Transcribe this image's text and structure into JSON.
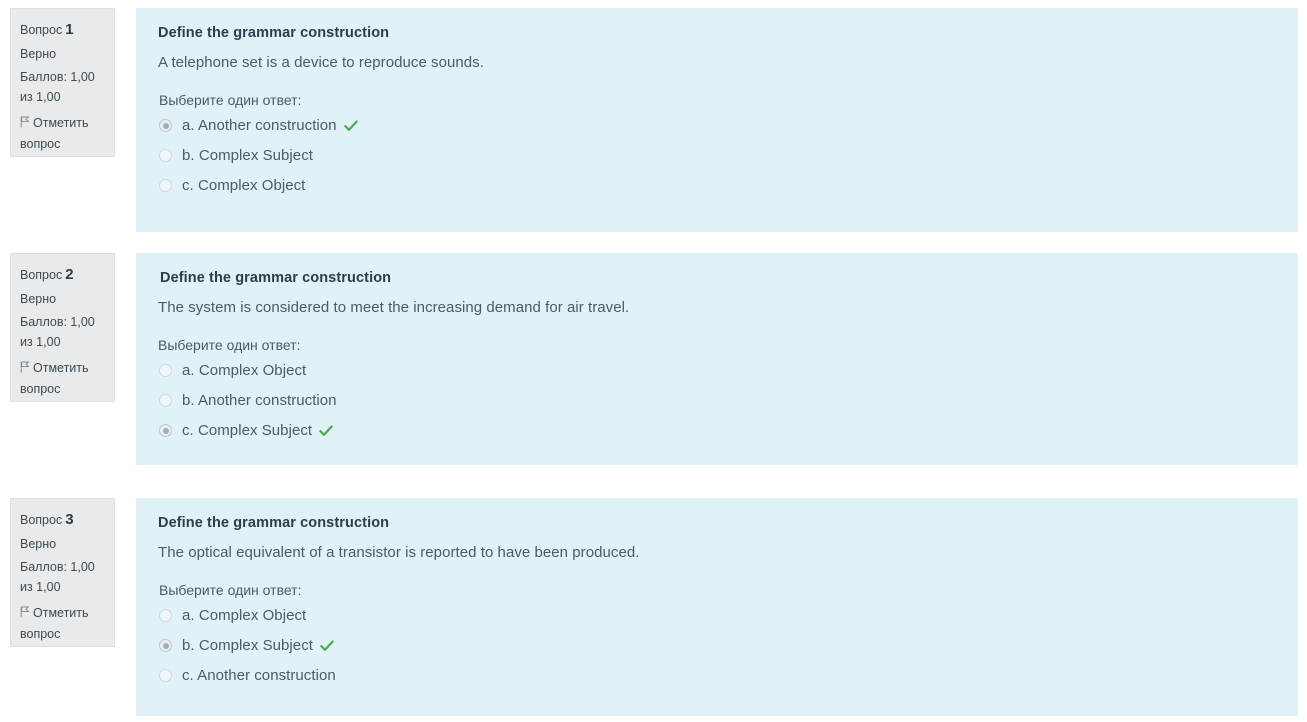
{
  "page": {
    "background": "#ffffff",
    "panel_color": "#e0f1f8",
    "sidebar_color": "#e8eaec",
    "correct_color": "#4fa84f",
    "heading_color": "#2c3e4c",
    "body_color": "#4b5b67"
  },
  "labels": {
    "question_word": "Вопрос",
    "state_correct": "Верно",
    "flag_question": "Отметить вопрос",
    "choose_one": "Выберите один ответ:",
    "flag_icon": "flag-icon",
    "correct_icon": "check-icon"
  },
  "questions": [
    {
      "number": "1",
      "state": "Верно",
      "grade": "Баллов: 1,00 из 1,00",
      "flag_label": "Отметить вопрос",
      "title": "Define the grammar construction",
      "text": "A telephone set is a device to reproduce sounds.",
      "prompt": "Выберите один ответ:",
      "answers": [
        {
          "label": "a. Another construction",
          "selected": true,
          "correct": true
        },
        {
          "label": "b. Complex Subject",
          "selected": false,
          "correct": false
        },
        {
          "label": "c. Complex Object",
          "selected": false,
          "correct": false
        }
      ]
    },
    {
      "number": "2",
      "state": "Верно",
      "grade": "Баллов: 1,00 из 1,00",
      "flag_label": "Отметить вопрос",
      "title": "Define the grammar construction",
      "text": "The system is considered to meet the increasing demand for air travel.",
      "prompt": "Выберите один ответ:",
      "answers": [
        {
          "label": "a. Complex Object",
          "selected": false,
          "correct": false
        },
        {
          "label": "b. Another construction",
          "selected": false,
          "correct": false
        },
        {
          "label": "c. Complex Subject",
          "selected": true,
          "correct": true
        }
      ]
    },
    {
      "number": "3",
      "state": "Верно",
      "grade": "Баллов: 1,00 из 1,00",
      "flag_label": "Отметить вопрос",
      "title": "Define the grammar construction",
      "text": "The optical equivalent of a transistor is reported to have been produced.",
      "prompt": "Выберите один ответ:",
      "answers": [
        {
          "label": "a. Complex Object",
          "selected": false,
          "correct": false
        },
        {
          "label": "b. Complex Subject",
          "selected": true,
          "correct": true
        },
        {
          "label": "c. Another construction",
          "selected": false,
          "correct": false
        }
      ]
    }
  ]
}
